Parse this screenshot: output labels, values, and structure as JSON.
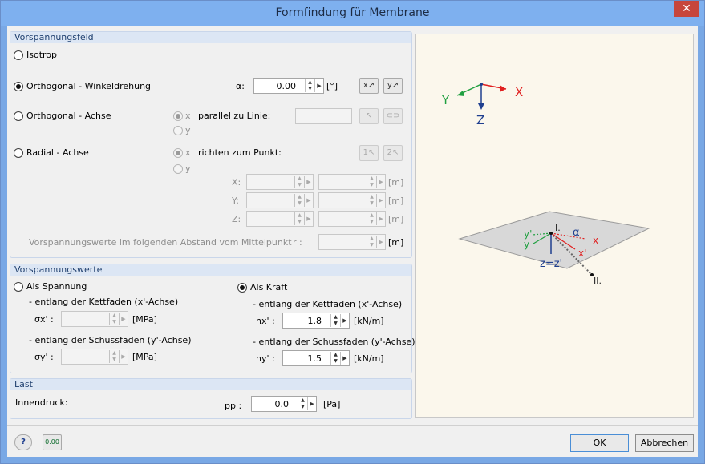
{
  "window": {
    "title": "Formfindung für Membrane",
    "close_glyph": "✕"
  },
  "prestress_field": {
    "header": "Vorspannungsfeld",
    "isotrop": "Isotrop",
    "orthogonal_rotation": "Orthogonal - Winkeldrehung",
    "alpha_label": "α:",
    "alpha_value": "0.00",
    "alpha_unit": "[°]",
    "orthogonal_axis": "Orthogonal - Achse",
    "radial_axis": "Radial - Achse",
    "x_label": "x",
    "y_label": "y",
    "parallel_to_line": "parallel zu Linie:",
    "direct_to_point": "richten zum Punkt:",
    "coord_x": "X:",
    "coord_y": "Y:",
    "coord_z": "Z:",
    "unit_m": "[m]",
    "distance_label": "Vorspannungswerte im folgenden Abstand vom Mittelpunkt",
    "r_label": "r :",
    "selected": "orthogonal_rotation"
  },
  "prestress_values": {
    "header": "Vorspannungswerte",
    "as_stress": "Als Spannung",
    "warp_stress": "- entlang der Kettfaden (x'-Achse)",
    "sigma_x": "σx' :",
    "weft_stress": "- entlang der Schussfaden (y'-Achse)",
    "sigma_y": "σy' :",
    "unit_mpa": "[MPa]",
    "as_force": "Als Kraft",
    "warp_force": "- entlang der Kettfaden (x'-Achse)",
    "n_x": "nx' :",
    "n_x_value": "1.8",
    "weft_force": "- entlang der Schussfaden (y'-Achse)",
    "n_y": "ny' :",
    "n_y_value": "1.5",
    "unit_knm": "[kN/m]",
    "selected": "as_force"
  },
  "load": {
    "header": "Last",
    "internal_pressure": "Innendruck:",
    "pp_label": "pp :",
    "pp_value": "0.0",
    "pp_unit": "[Pa]"
  },
  "preview": {
    "axis_x": "X",
    "axis_y": "Y",
    "axis_z": "Z",
    "label_i": "I.",
    "label_ii": "II.",
    "label_alpha": "α",
    "label_xprime": "x'",
    "label_yprime": "y'",
    "label_x": "x",
    "label_y": "y",
    "label_zz": "z=z'"
  },
  "footer": {
    "help_icon": "?",
    "units_icon": "0.00",
    "ok": "OK",
    "cancel": "Abbrechen"
  },
  "colors": {
    "accent": "#2b5797",
    "axis_x": "#e02020",
    "axis_y": "#20a040",
    "axis_z": "#1f3f8f"
  }
}
